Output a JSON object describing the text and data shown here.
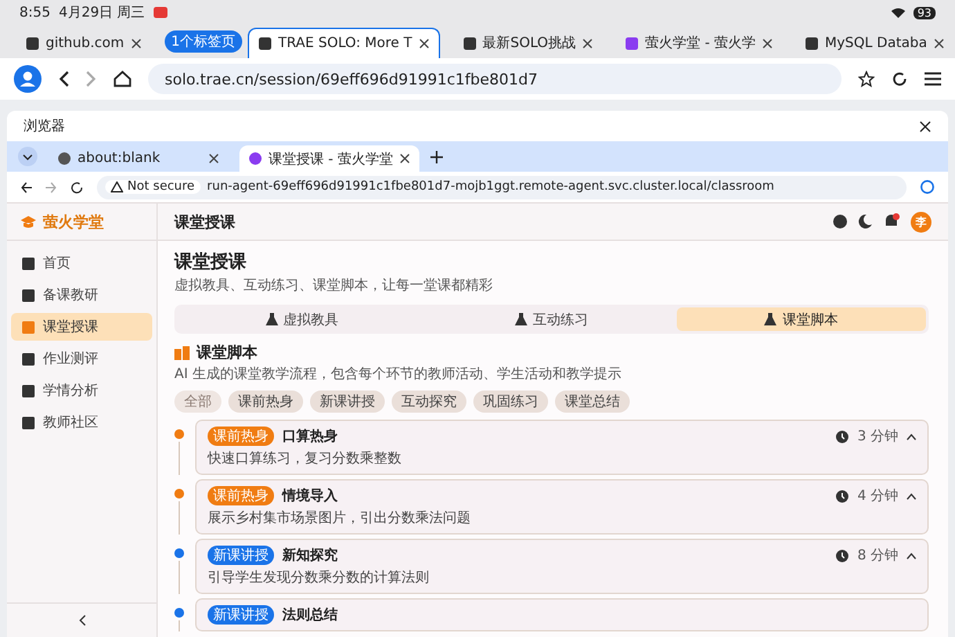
{
  "status_bar": {
    "time": "8:55",
    "date": "4月29日 周三",
    "battery": "93"
  },
  "browser": {
    "tab_group": "1个标签页",
    "tabs": [
      {
        "label": "github.com",
        "selected": false
      },
      {
        "label": "TRAE SOLO: More T",
        "selected": true
      },
      {
        "label": "最新SOLO挑战",
        "selected": false
      },
      {
        "label": "萤火学堂 - 萤火学",
        "selected": false
      },
      {
        "label": "MySQL Databa",
        "selected": false
      }
    ],
    "url": "solo.trae.cn/session/69eff696d91991c1fbe801d7"
  },
  "panel": {
    "title": "浏览器",
    "tabs": [
      {
        "label": "about:blank",
        "selected": false
      },
      {
        "label": "课堂授课 - 萤火学堂",
        "selected": true
      }
    ],
    "security": "Not secure",
    "url": "run-agent-69eff696d91991c1fbe801d7-mojb1ggt.remote-agent.svc.cluster.local/classroom"
  },
  "app": {
    "brand": "萤火学堂",
    "header": "课堂授课",
    "avatar": "李",
    "sidebar": {
      "items": [
        {
          "label": "首页",
          "selected": false
        },
        {
          "label": "备课教研",
          "selected": false
        },
        {
          "label": "课堂授课",
          "selected": true
        },
        {
          "label": "作业测评",
          "selected": false
        },
        {
          "label": "学情分析",
          "selected": false
        },
        {
          "label": "教师社区",
          "selected": false
        }
      ]
    },
    "page_title": "课堂授课",
    "page_subtitle": "虚拟教具、互动练习、课堂脚本，让每一堂课都精彩",
    "tabs": [
      {
        "label": "虚拟教具",
        "selected": false
      },
      {
        "label": "互动练习",
        "selected": false
      },
      {
        "label": "课堂脚本",
        "selected": true
      }
    ],
    "section_title": "课堂脚本",
    "section_desc": "AI 生成的课堂教学流程，包含每个环节的教师活动、学生活动和教学提示",
    "filters": [
      {
        "label": "全部",
        "selected": true
      },
      {
        "label": "课前热身",
        "selected": false
      },
      {
        "label": "新课讲授",
        "selected": false
      },
      {
        "label": "互动探究",
        "selected": false
      },
      {
        "label": "巩固练习",
        "selected": false
      },
      {
        "label": "课堂总结",
        "selected": false
      }
    ],
    "steps": [
      {
        "tag": "课前热身",
        "title": "口算热身",
        "desc": "快速口算练习，复习分数乘整数",
        "duration": "3 分钟",
        "color": "#f07c12"
      },
      {
        "tag": "课前热身",
        "title": "情境导入",
        "desc": "展示乡村集市场景图片，引出分数乘法问题",
        "duration": "4 分钟",
        "color": "#f07c12"
      },
      {
        "tag": "新课讲授",
        "title": "新知探究",
        "desc": "引导学生发现分数乘分数的计算法则",
        "duration": "8 分钟",
        "color": "#1a73e8"
      },
      {
        "tag": "新课讲授",
        "title": "法则总结",
        "color": "#1a73e8"
      }
    ]
  }
}
